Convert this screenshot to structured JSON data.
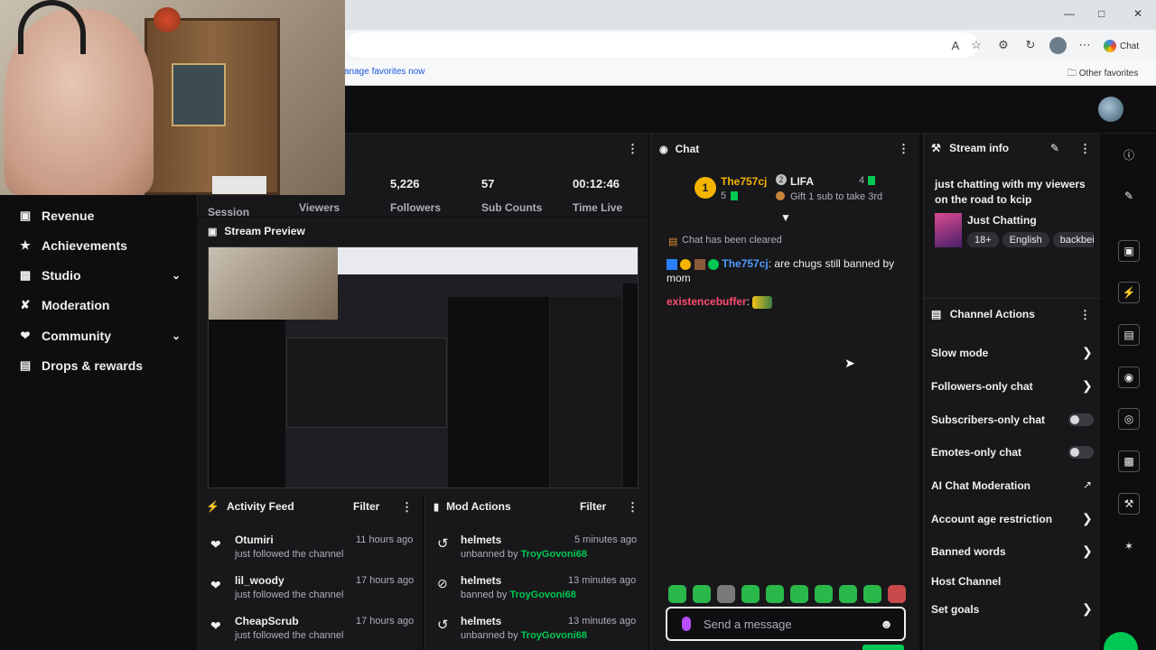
{
  "browser": {
    "favorites_link": "anage favorites now",
    "other_favorites": "Other favorites",
    "chat_button": "Chat"
  },
  "nav": {
    "items": [
      {
        "label": "Revenue",
        "icon": "revenue-icon"
      },
      {
        "label": "Achievements",
        "icon": "trophy-icon"
      },
      {
        "label": "Studio",
        "icon": "studio-icon",
        "expandable": true
      },
      {
        "label": "Moderation",
        "icon": "wrench-icon"
      },
      {
        "label": "Community",
        "icon": "community-icon",
        "expandable": true
      },
      {
        "label": "Drops & rewards",
        "icon": "gift-icon"
      }
    ]
  },
  "stats": [
    {
      "value": "",
      "label": "Session"
    },
    {
      "value": "",
      "label": "Viewers"
    },
    {
      "value": "5,226",
      "label": "Followers"
    },
    {
      "value": "57",
      "label": "Sub Counts"
    },
    {
      "value": "00:12:46",
      "label": "Time Live"
    }
  ],
  "preview": {
    "title": "Stream Preview"
  },
  "activity_feed": {
    "title": "Activity Feed",
    "filter": "Filter",
    "items": [
      {
        "name": "Otumiri",
        "text": "just followed the channel",
        "time": "11 hours ago"
      },
      {
        "name": "lil_woody",
        "text": "just followed the channel",
        "time": "17 hours ago"
      },
      {
        "name": "CheapScrub",
        "text": "just followed the channel",
        "time": "17 hours ago"
      }
    ]
  },
  "mod_actions": {
    "title": "Mod Actions",
    "filter": "Filter",
    "items": [
      {
        "name": "helmets",
        "action": "unbanned by",
        "by": "TroyGovoni68",
        "time": "5 minutes ago",
        "icon": "undo-icon"
      },
      {
        "name": "helmets",
        "action": "banned by",
        "by": "TroyGovoni68",
        "time": "13 minutes ago",
        "icon": "ban-icon"
      },
      {
        "name": "helmets",
        "action": "unbanned by",
        "by": "TroyGovoni68",
        "time": "13 minutes ago",
        "icon": "undo-icon"
      }
    ]
  },
  "chat": {
    "title": "Chat",
    "leaderboard": {
      "first_name": "The757cj",
      "first_count": "5",
      "second_name": "LIFA",
      "second_count": "4",
      "gift_text": "Gift 1 sub to take 3rd"
    },
    "cleared": "Chat has been cleared",
    "messages": [
      {
        "user": "The757cj",
        "text": ": are chugs still banned by mom",
        "color": "#4f9cff"
      },
      {
        "user": "existencebuffer",
        "text": ":",
        "color": "#ff4d6d"
      }
    ],
    "input_placeholder": "Send a message"
  },
  "stream_info": {
    "title": "Stream info",
    "stream_title": "just chatting with my viewers on the road to kcip",
    "category": "Just Chatting",
    "tags": [
      "18+",
      "English",
      "backbei"
    ]
  },
  "channel_actions": {
    "title": "Channel Actions",
    "items": [
      {
        "label": "Slow mode",
        "control": "chevron"
      },
      {
        "label": "Followers-only chat",
        "control": "chevron"
      },
      {
        "label": "Subscribers-only chat",
        "control": "toggle",
        "on": false
      },
      {
        "label": "Emotes-only chat",
        "control": "toggle",
        "on": false
      },
      {
        "label": "AI Chat Moderation",
        "control": "external"
      },
      {
        "label": "Account age restriction",
        "control": "chevron"
      },
      {
        "label": "Banned words",
        "control": "chevron"
      },
      {
        "label": "Host Channel",
        "control": "none"
      },
      {
        "label": "Set goals",
        "control": "chevron"
      }
    ]
  },
  "colors": {
    "accent_green": "#00c853",
    "purple": "#9147ff",
    "panel": "#18181b"
  }
}
